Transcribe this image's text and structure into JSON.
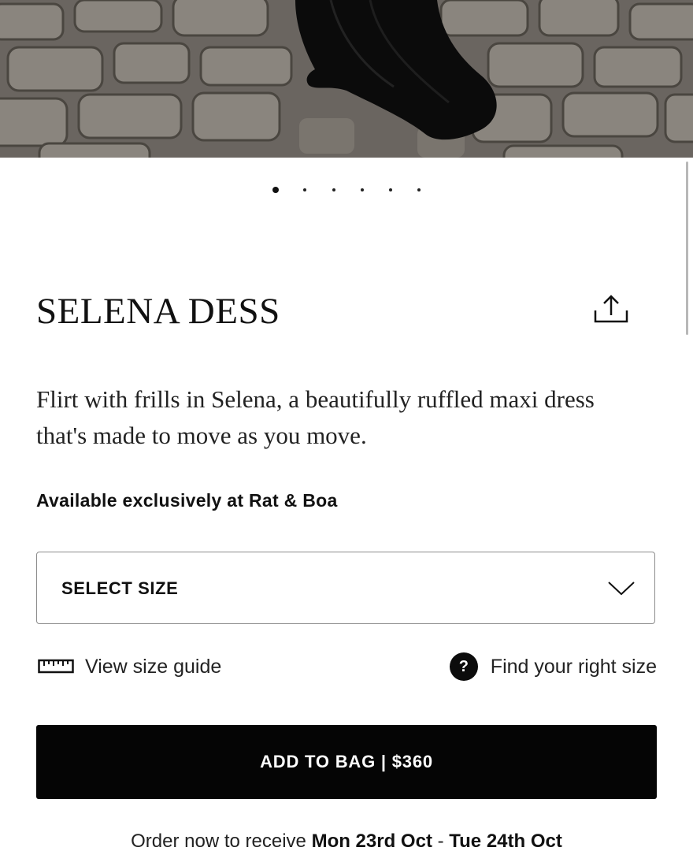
{
  "product": {
    "title": "SELENA DESS",
    "description": "Flirt with frills in Selena, a beautifully ruffled maxi dress that's made to move as you move.",
    "exclusive_note": "Available exclusively at Rat & Boa"
  },
  "gallery": {
    "image_count": 6,
    "active_index": 0
  },
  "size_select": {
    "label": "SELECT SIZE"
  },
  "size_help": {
    "guide_label": "View size guide",
    "fit_label": "Find your right size",
    "fit_icon": "?"
  },
  "cart": {
    "button_label": "ADD TO BAG | $360"
  },
  "delivery": {
    "prefix": "Order now to receive ",
    "start": "Mon 23rd Oct",
    "separator": " - ",
    "end": "Tue 24th Oct"
  },
  "colors": {
    "button_bg": "#050505",
    "text": "#111111",
    "border": "#8c8c8c"
  }
}
